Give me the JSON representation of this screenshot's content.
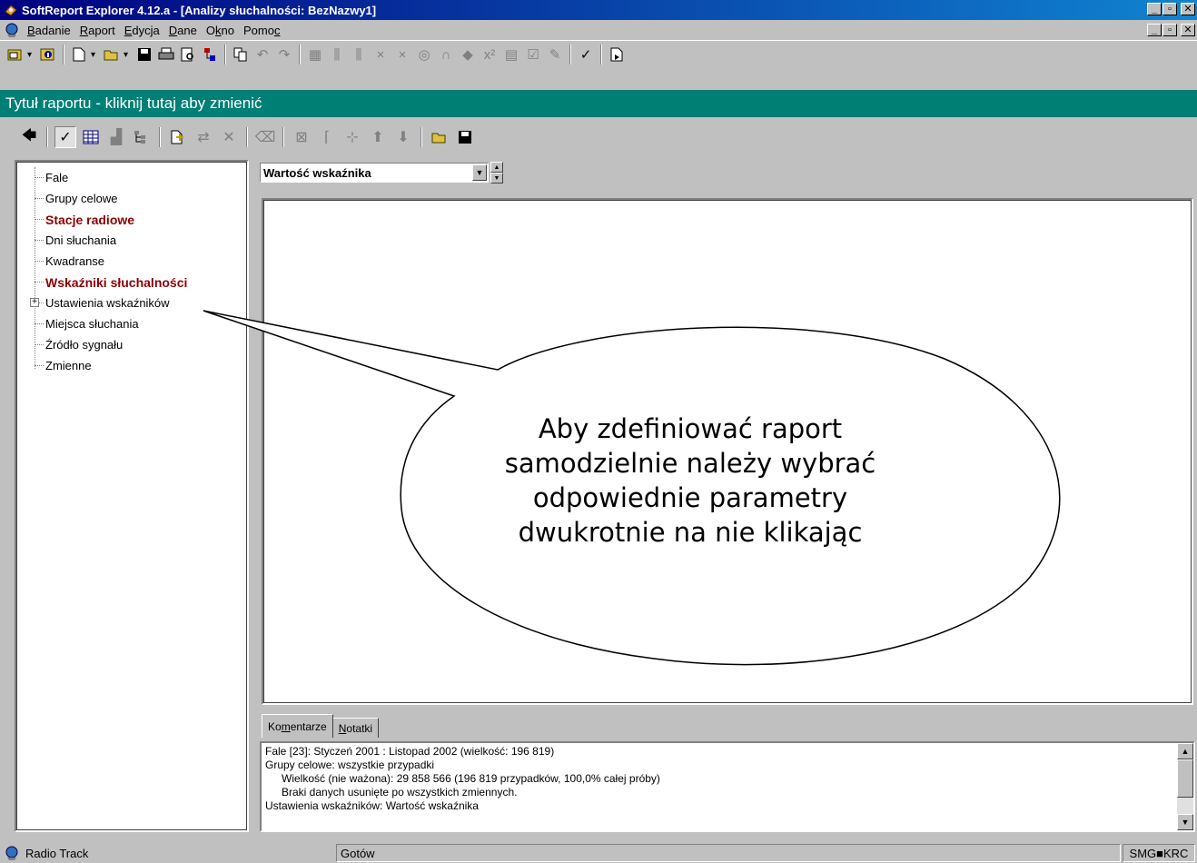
{
  "window": {
    "title": "SoftReport Explorer 4.12.a - [Analizy słuchalności: BezNazwy1]",
    "controls": {
      "minimize": "_",
      "restore": "▫",
      "close": "✕"
    }
  },
  "menu": {
    "items": [
      {
        "pre": "",
        "key": "B",
        "post": "adanie"
      },
      {
        "pre": "",
        "key": "R",
        "post": "aport"
      },
      {
        "pre": "",
        "key": "E",
        "post": "dycja"
      },
      {
        "pre": "",
        "key": "D",
        "post": "ane"
      },
      {
        "pre": "O",
        "key": "k",
        "post": "no"
      },
      {
        "pre": "Pomo",
        "key": "c",
        "post": ""
      }
    ]
  },
  "report_title": "Tytuł raportu - kliknij tutaj aby zmienić",
  "tree": {
    "items": [
      {
        "label": "Fale",
        "bold": false
      },
      {
        "label": "Grupy celowe",
        "bold": false
      },
      {
        "label": "Stacje radiowe",
        "bold": true
      },
      {
        "label": "Dni słuchania",
        "bold": false
      },
      {
        "label": "Kwadranse",
        "bold": false
      },
      {
        "label": "Wskaźniki słuchalności",
        "bold": true
      },
      {
        "label": "Ustawienia wskaźników",
        "bold": false
      },
      {
        "label": "Miejsca słuchania",
        "bold": false
      },
      {
        "label": "Źródło sygnału",
        "bold": false
      },
      {
        "label": "Zmienne",
        "bold": false
      }
    ],
    "expander": "+"
  },
  "indicator_select": {
    "value": "Wartość wskaźnika"
  },
  "tabs": [
    {
      "pre": "Ko",
      "key": "m",
      "post": "entarze"
    },
    {
      "pre": "",
      "key": "N",
      "post": "otatki"
    }
  ],
  "comments": [
    "Fale [23]: Styczeń 2001 : Listopad 2002 (wielkość: 196 819)",
    "Grupy celowe: wszystkie przypadki",
    "Wielkość (nie ważona): 29 858 566 (196 819 przypadków, 100,0% całej próby)",
    "Braki danych usunięte po wszystkich zmiennych.",
    "Ustawienia wskaźników: Wartość wskaźnika"
  ],
  "status": {
    "app": "Radio Track",
    "state": "Gotów",
    "code": "SMG■KRC"
  },
  "callout": {
    "lines": [
      "Aby zdefiniować raport",
      "samodzielnie należy wybrać",
      "odpowiednie parametry",
      "dwukrotnie na nie klikając"
    ]
  }
}
